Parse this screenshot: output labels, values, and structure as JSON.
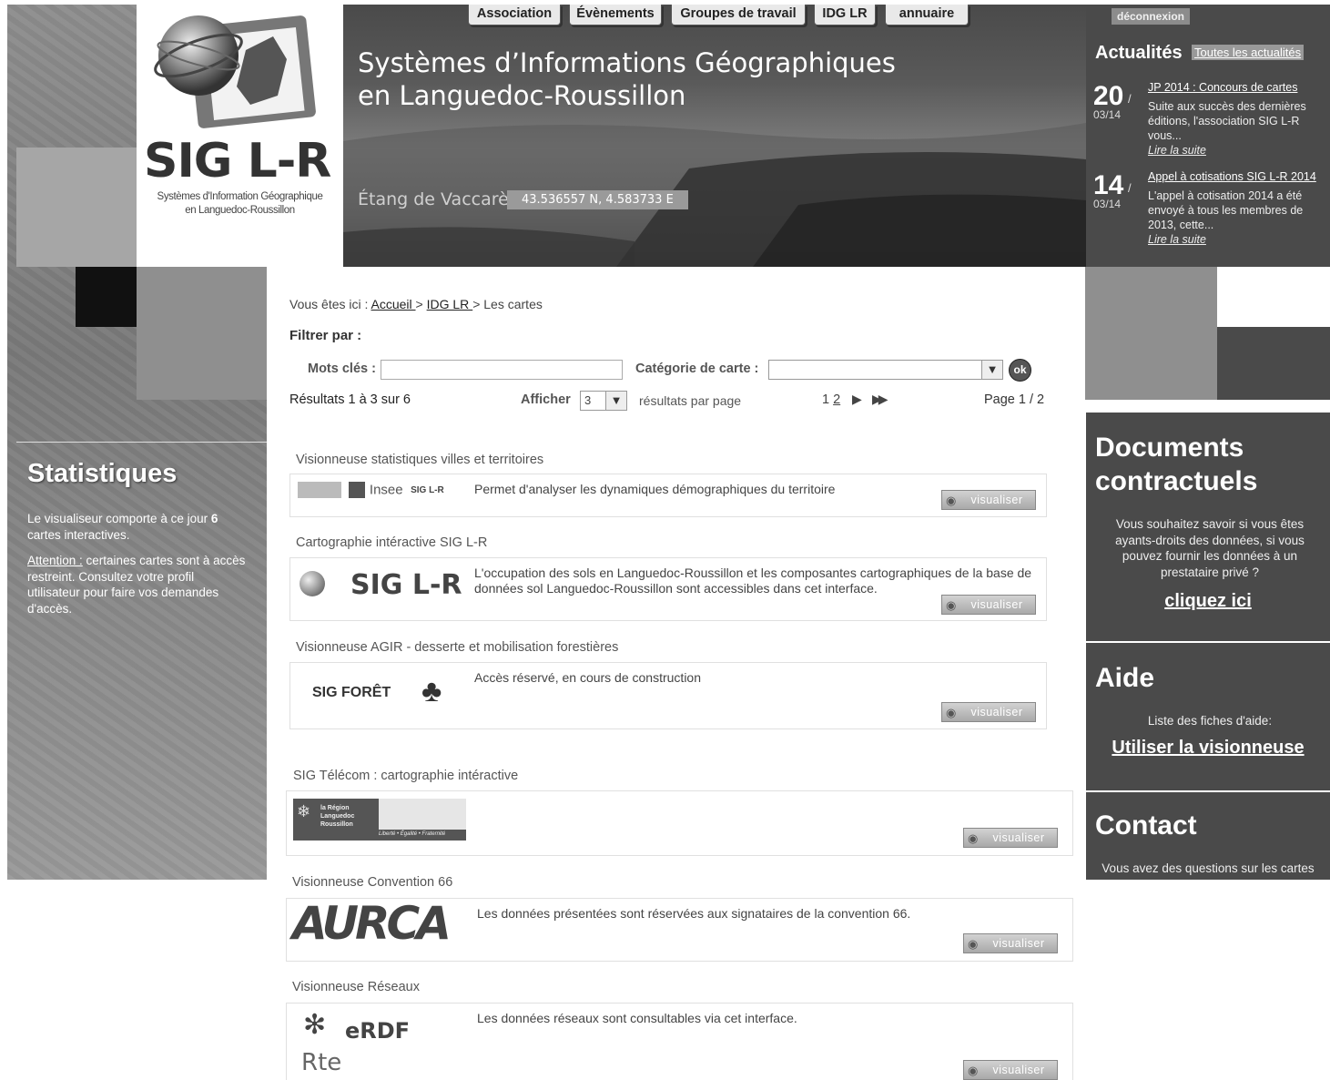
{
  "nav": {
    "tabs": [
      "Association",
      "Évènements",
      "Groupes de travail",
      "IDG LR",
      "annuaire"
    ]
  },
  "logo": {
    "name": "SIG  L-R",
    "subtitle_line1": "Systèmes d'Information Géographique",
    "subtitle_line2": "en Languedoc-Roussillon"
  },
  "banner": {
    "title_line1": "Systèmes d’Informations Géographiques",
    "title_line2": "en Languedoc-Roussillon",
    "caption": "Étang de Vaccarès",
    "coords": "43.536557 N, 4.583733 E"
  },
  "account": {
    "logout_label": "déconnexion"
  },
  "news": {
    "title": "Actualités",
    "all_link": "Toutes les actualités",
    "items": [
      {
        "day": "20",
        "month": "03/14",
        "headline": "JP 2014 : Concours de cartes",
        "text": "Suite aux succès des dernières éditions, l'association SIG L-R vous...",
        "more": "Lire la suite"
      },
      {
        "day": "14",
        "month": "03/14",
        "headline": "Appel à cotisations SIG L-R 2014",
        "text": "L'appel à cotisation 2014 a été envoyé à tous les membres de 2013, cette...",
        "more": "Lire la suite"
      }
    ]
  },
  "stats": {
    "title": "Statistiques",
    "text_prefix": "Le visualiseur comporte à ce jour ",
    "count": "6",
    "text_suffix": " cartes interactives.",
    "attention_label": "Attention :",
    "attention_text": " certaines cartes sont à accès restreint. Consultez votre profil utilisateur pour faire vos demandes d'accès."
  },
  "breadcrumb": {
    "prefix": "Vous êtes ici : ",
    "home": "Accueil ",
    "sep1": "> ",
    "idg": "IDG LR ",
    "sep2": "> ",
    "current": "Les cartes"
  },
  "filter": {
    "title": "Filtrer par :",
    "keywords_label": "Mots clés :",
    "keywords_value": "",
    "category_label": "Catégorie de carte :",
    "category_value": "",
    "ok_label": "ok"
  },
  "results": {
    "summary": "Résultats 1 à 3 sur 6",
    "show_label": "Afficher",
    "per_page": "3",
    "per_page_suffix": "résultats par page",
    "page_1": "1",
    "page_2": "2",
    "page_of": "Page 1 / 2"
  },
  "maps": [
    {
      "title": "Visionneuse statistiques villes et territoires",
      "logo_text": "Insee",
      "logo_text2": "SIG L-R",
      "description": "Permet d'analyser les dynamiques démographiques du territoire",
      "button": "visualiser"
    },
    {
      "title": "Cartographie intéractive SIG L-R",
      "logo_text": "SIG  L-R",
      "description": "L'occupation des sols en Languedoc-Roussillon et les composantes cartographiques de la base de données sol Languedoc-Roussillon sont accessibles dans cet interface.",
      "button": "visualiser"
    },
    {
      "title": "Visionneuse AGIR - desserte et mobilisation forestières",
      "logo_text": "SIG FORÊT",
      "description": "Accès réservé, en cours de construction",
      "button": "visualiser"
    },
    {
      "title": "SIG Télécom : cartographie intéractive",
      "logo_text": "la Région Languedoc Roussillon",
      "logo_text2": "Liberté • Égalité • Fraternité",
      "description": "",
      "button": "visualiser"
    },
    {
      "title": "Visionneuse Convention 66",
      "logo_text": "AURCA",
      "description": "Les données présentées sont réservées aux signataires de la convention 66.",
      "button": "visualiser"
    },
    {
      "title": "Visionneuse Réseaux",
      "logo_text": "eRDF",
      "logo_text2": "Rte",
      "description": "Les données réseaux sont consultables via cet interface.",
      "button": "visualiser"
    }
  ],
  "documents": {
    "title_line1": "Documents",
    "title_line2": "contractuels",
    "text": "Vous souhaitez savoir si vous êtes ayants-droits des données, si vous pouvez fournir les données à un prestataire privé ?",
    "link": "cliquez ici"
  },
  "help": {
    "title": "Aide",
    "text": "Liste des fiches d'aide:",
    "link": "Utiliser la visionneuse"
  },
  "contact": {
    "title": "Contact",
    "text": "Vous avez des questions sur les cartes"
  }
}
